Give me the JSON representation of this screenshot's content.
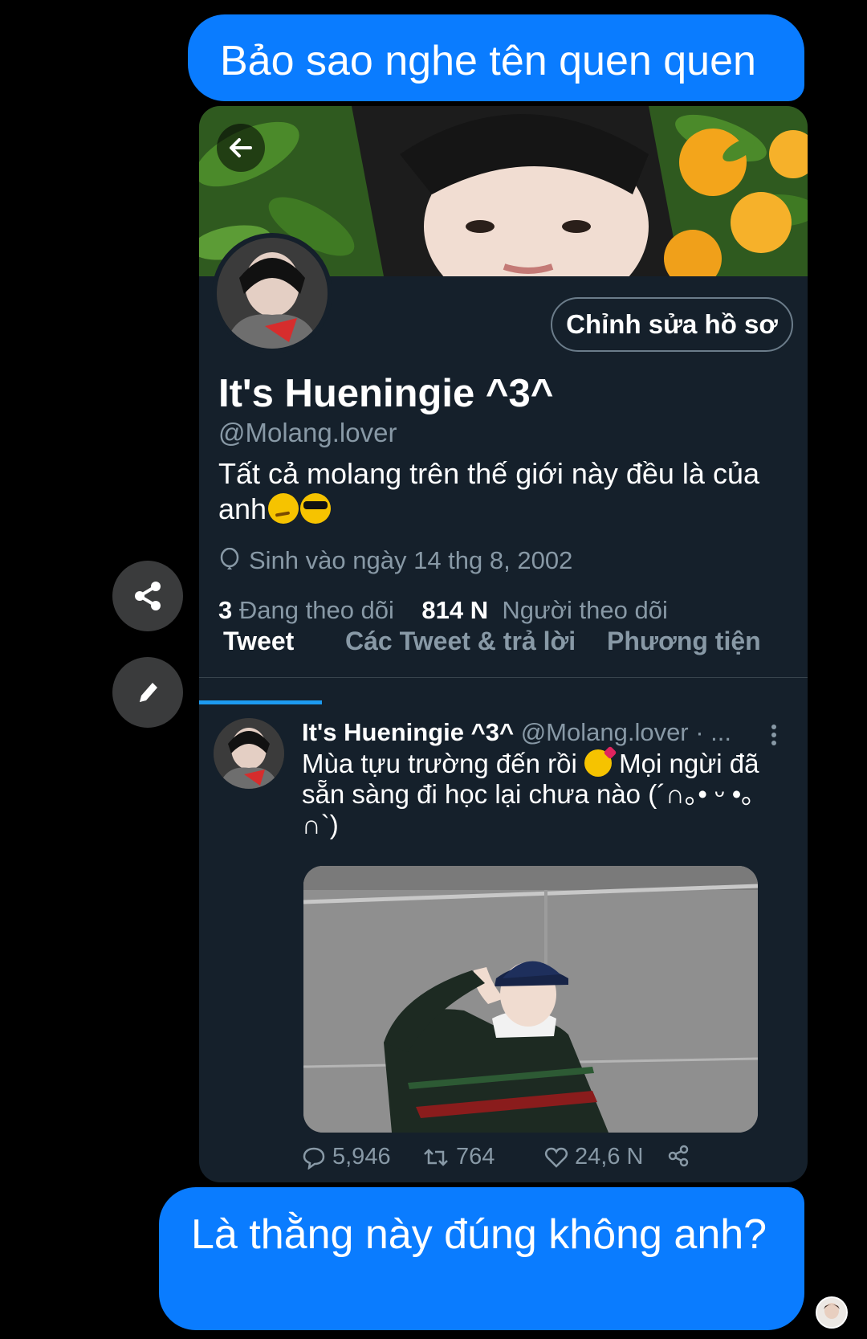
{
  "chat": {
    "message_top": "Bảo sao nghe tên quen quen",
    "message_bottom": "Là thằng này đúng không anh?"
  },
  "side_actions": {
    "share_icon": "share-icon",
    "edit_icon": "pencil-icon"
  },
  "profile": {
    "back_icon": "arrow-left-icon",
    "edit_button": "Chỉnh sửa hồ sơ",
    "display_name": "It's Hueningie ^3^",
    "handle": "@Molang.lover",
    "bio": "Tất cả molang trên thế giới này đều là của anh",
    "birth_icon": "balloon-icon",
    "birth": "Sinh vào ngày 14 thg 8, 2002",
    "following_count": "3",
    "following_label": "Đang theo dõi",
    "followers_count": "814 N",
    "followers_label": "Người theo dõi"
  },
  "tabs": [
    {
      "label": "Tweet",
      "active": true
    },
    {
      "label": "Các Tweet & trả lời",
      "active": false
    },
    {
      "label": "Phương tiện",
      "active": false
    }
  ],
  "tweet": {
    "name": "It's Hueningie ^3^",
    "meta": "@Molang.lover · ...",
    "text_part1": "Mùa tựu trường đến rồi",
    "text_part2": "Mọi ngừi đã sẵn sàng đi học lại chưa nào (´∩｡• ᵕ •｡∩`)",
    "replies": "5,946",
    "retweets": "764",
    "likes": "24,6 N"
  },
  "colors": {
    "bubble": "#0a7cff",
    "card_bg": "#15202b",
    "accent": "#1d9bf0",
    "muted_text": "#8899a6"
  }
}
